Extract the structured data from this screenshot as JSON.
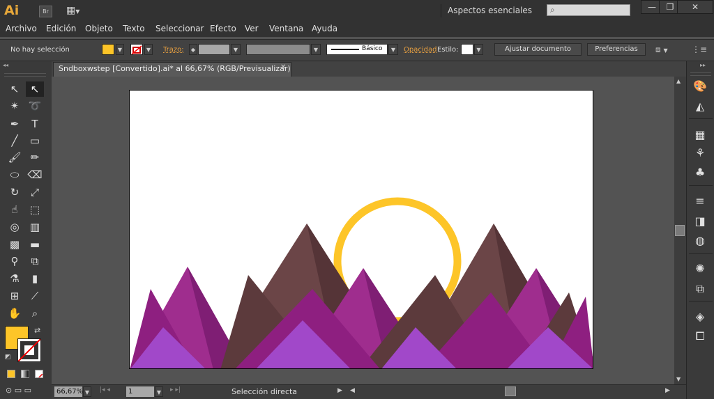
{
  "app": {
    "logo": "Ai",
    "bridge_label": "Br",
    "workspace": "Aspectos esenciales"
  },
  "menu": [
    "Archivo",
    "Edición",
    "Objeto",
    "Texto",
    "Seleccionar",
    "Efecto",
    "Ver",
    "Ventana",
    "Ayuda"
  ],
  "control": {
    "selection_status": "No hay selección",
    "stroke_label": "Trazo:",
    "profile_label": "Básico",
    "opacity_label": "Opacidad",
    "style_label": "Estilo:",
    "adjust_doc_button": "Ajustar documento",
    "preferences_button": "Preferencias",
    "fill_color": "#FDC528"
  },
  "document": {
    "tab_title": "Sndboxwstep [Convertido].ai* al 66,67% (RGB/Previsualizar)",
    "tab_close": "✕"
  },
  "status": {
    "zoom": "66,67%",
    "page": "1",
    "status_text": "Selección directa"
  },
  "colors": {
    "fill": "#FDC528",
    "sun": "#FDC528",
    "mountain_brown": "#5C3A3C",
    "mountain_magenta": "#9A1F8A",
    "mountain_purple": "#A148C9"
  },
  "tools": [
    "selection-tool",
    "direct-selection-tool",
    "magic-wand-tool",
    "lasso-tool",
    "pen-tool",
    "type-tool",
    "line-tool",
    "rectangle-tool",
    "paintbrush-tool",
    "pencil-tool",
    "blob-brush-tool",
    "eraser-tool",
    "rotate-tool",
    "scale-tool",
    "warp-tool",
    "free-transform-tool",
    "shape-builder-tool",
    "graph-tool",
    "mesh-tool",
    "gradient-tool",
    "eyedropper-tool",
    "blend-tool",
    "symbol-sprayer-tool",
    "column-graph-tool",
    "artboard-tool",
    "slice-tool",
    "hand-tool",
    "zoom-tool"
  ]
}
